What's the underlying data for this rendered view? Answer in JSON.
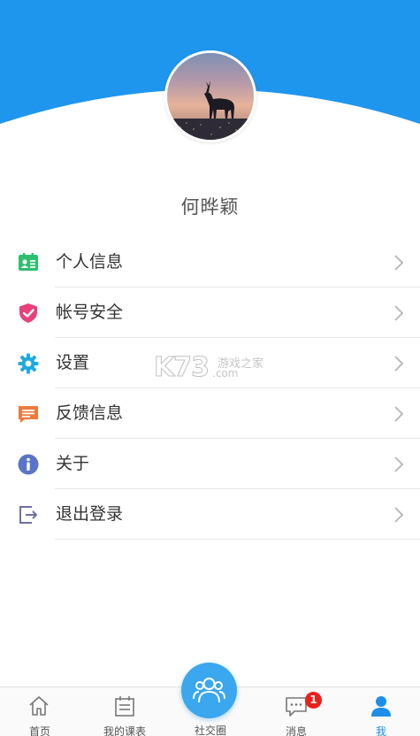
{
  "profile": {
    "name": "何晔颖"
  },
  "menu": {
    "items": [
      {
        "label": "个人信息",
        "icon": "id-card-icon",
        "color": "#2fbf71"
      },
      {
        "label": "帐号安全",
        "icon": "shield-icon",
        "color": "#e8407a"
      },
      {
        "label": "设置",
        "icon": "gear-icon",
        "color": "#1fa9e1"
      },
      {
        "label": "反馈信息",
        "icon": "feedback-icon",
        "color": "#f07a3a"
      },
      {
        "label": "关于",
        "icon": "info-icon",
        "color": "#5a74c9"
      },
      {
        "label": "退出登录",
        "icon": "logout-icon",
        "color": "#6c6fa8"
      }
    ]
  },
  "watermark": {
    "brand": "K73",
    "line1": "游戏之家",
    "line2": ".com"
  },
  "bottom_nav": {
    "items": [
      {
        "label": "首页",
        "icon": "home-icon"
      },
      {
        "label": "我的课表",
        "icon": "calendar-icon"
      },
      {
        "label": "社交圈",
        "icon": "people-icon"
      },
      {
        "label": "消息",
        "icon": "chat-icon",
        "badge": "1"
      },
      {
        "label": "我",
        "icon": "person-icon",
        "active": true
      }
    ]
  },
  "colors": {
    "header": "#1e96ee",
    "accent": "#1e8fe8",
    "badge": "#e8211c",
    "fab": "#3aa7ee"
  }
}
